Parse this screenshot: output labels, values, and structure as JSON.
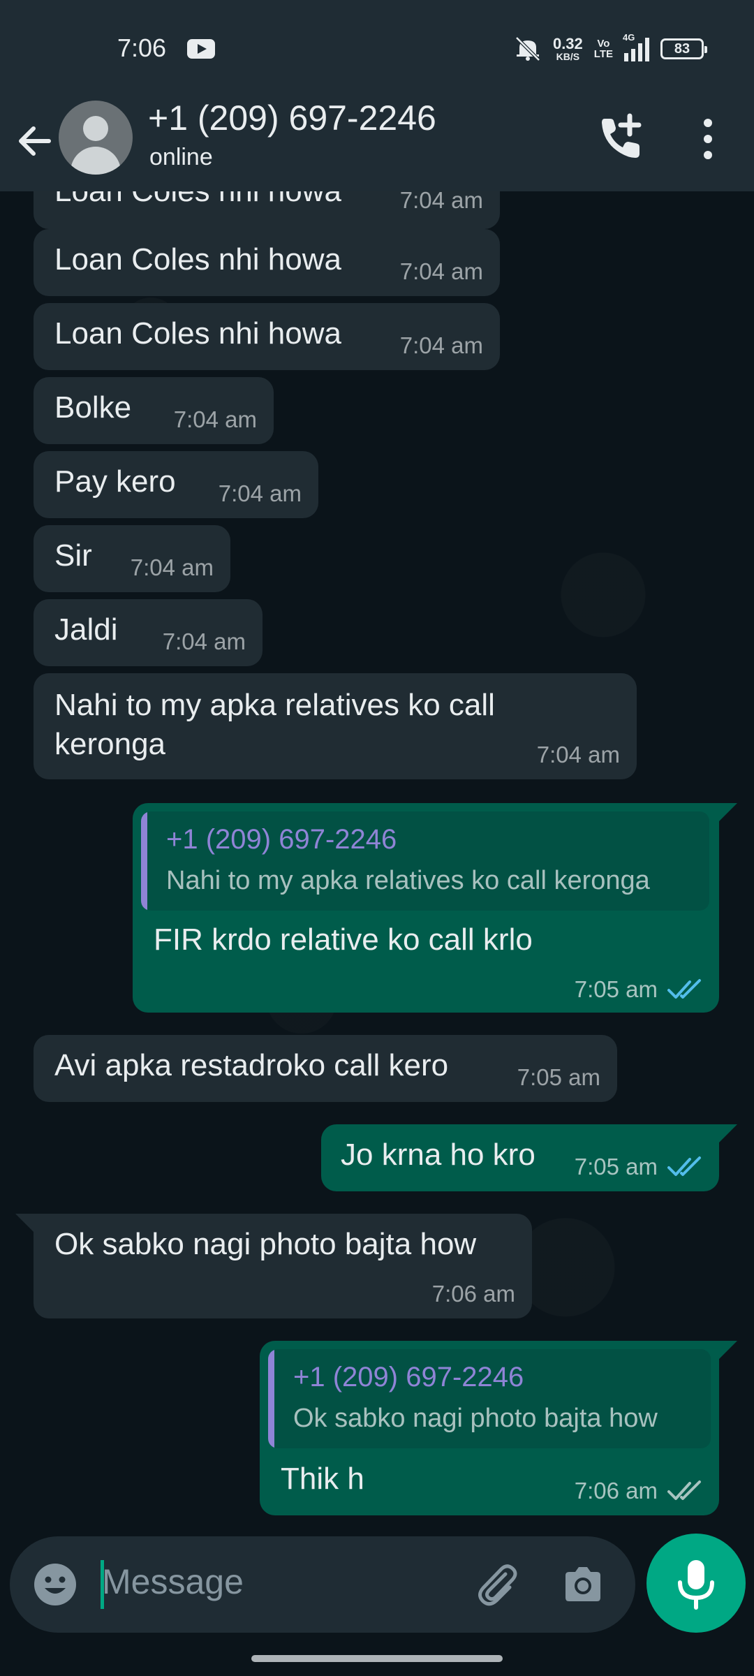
{
  "status_bar": {
    "time": "7:06",
    "net_speed_value": "0.32",
    "net_speed_unit": "KB/S",
    "volte_top": "Vo",
    "volte_bottom": "LTE",
    "network_type": "4G",
    "battery": "83",
    "icons": [
      "youtube-icon",
      "mute-icon",
      "signal-icon",
      "battery-icon"
    ]
  },
  "header": {
    "contact_name": "+1 (209) 697-2246",
    "status": "online",
    "icons": [
      "back-arrow-icon",
      "avatar",
      "add-call-icon",
      "more-vert-icon"
    ]
  },
  "messages": [
    {
      "direction": "in",
      "text": "Loan Coles nhi howa",
      "time": "7:04 am",
      "clipped": true
    },
    {
      "direction": "in",
      "text": "Loan Coles nhi howa",
      "time": "7:04 am"
    },
    {
      "direction": "in",
      "text": "Loan Coles nhi howa",
      "time": "7:04 am"
    },
    {
      "direction": "in",
      "text": "Bolke",
      "time": "7:04 am"
    },
    {
      "direction": "in",
      "text": "Pay kero",
      "time": "7:04 am"
    },
    {
      "direction": "in",
      "text": "Sir",
      "time": "7:04 am"
    },
    {
      "direction": "in",
      "text": "Jaldi",
      "time": "7:04 am"
    },
    {
      "direction": "in",
      "text": "Nahi to my apka relatives ko call keronga",
      "time": "7:04 am"
    },
    {
      "direction": "out",
      "quote_name": "+1 (209) 697-2246",
      "quote_text": "Nahi to my apka relatives ko call keronga",
      "text": "FIR  krdo  relative ko call krlo",
      "time": "7:05 am",
      "ticks": "read"
    },
    {
      "direction": "in",
      "text": "Avi apka restadroko call kero",
      "time": "7:05 am"
    },
    {
      "direction": "out",
      "text": "Jo krna ho kro",
      "time": "7:05 am",
      "ticks": "read"
    },
    {
      "direction": "in",
      "text": "Ok sabko nagi photo bajta how",
      "time": "7:06 am"
    },
    {
      "direction": "out",
      "quote_name": "+1 (209) 697-2246",
      "quote_text": "Ok sabko nagi photo bajta how",
      "text": "Thik h",
      "time": "7:06 am",
      "ticks": "delivered"
    }
  ],
  "composer": {
    "placeholder": "Message",
    "icons": [
      "emoji-icon",
      "attach-icon",
      "camera-icon",
      "mic-icon"
    ]
  },
  "colors": {
    "incoming_bubble": "#202c33",
    "outgoing_bubble": "#005c4b",
    "accent": "#00a884",
    "read_ticks": "#53bdeb",
    "quote_name": "#8f84d6"
  }
}
